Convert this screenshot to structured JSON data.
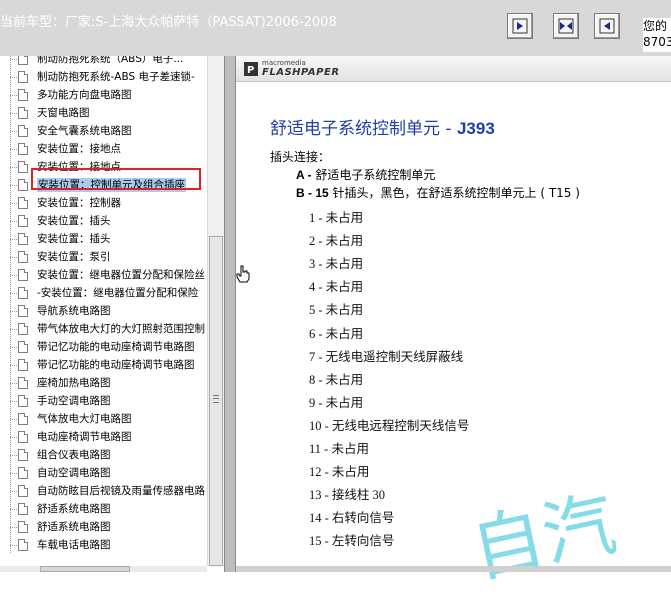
{
  "header": {
    "title": "当前车型：厂家:S-上海大众帕萨特（PASSAT)2006-2008",
    "right_info_line1": "您的",
    "right_info_line2": "8703"
  },
  "nav": {
    "icons": [
      "prev-page-icon",
      "fit-page-icon",
      "next-page-icon"
    ]
  },
  "tree": {
    "items": [
      {
        "label": "制动防抱死系统（ABS）电子..."
      },
      {
        "label": "制动防抱死系统-ABS 电子差速锁-"
      },
      {
        "label": "多功能方向盘电路图"
      },
      {
        "label": "天窗电路图"
      },
      {
        "label": "安全气囊系统电路图"
      },
      {
        "label": "安装位置：接地点"
      },
      {
        "label": "安装位置：接地点"
      },
      {
        "label": "安装位置：控制单元及组合插座",
        "selected": true
      },
      {
        "label": "安装位置：控制器"
      },
      {
        "label": "安装位置：插头"
      },
      {
        "label": "安装位置：插头"
      },
      {
        "label": "安装位置：泵引"
      },
      {
        "label": "安装位置：继电器位置分配和保险丝"
      },
      {
        "label": "-安装位置：继电器位置分配和保险"
      },
      {
        "label": "导航系统电路图"
      },
      {
        "label": "带气体放电大灯的大灯照射范围控制"
      },
      {
        "label": "带记忆功能的电动座椅调节电路图"
      },
      {
        "label": "带记忆功能的电动座椅调节电路图"
      },
      {
        "label": "座椅加热电路图"
      },
      {
        "label": "手动空调电路图"
      },
      {
        "label": "气体放电大灯电路图"
      },
      {
        "label": "电动座椅调节电路图"
      },
      {
        "label": "组合仪表电路图"
      },
      {
        "label": "自动空调电路图"
      },
      {
        "label": "自动防眩目后视镜及雨量传感器电路"
      },
      {
        "label": "舒适系统电路图"
      },
      {
        "label": "舒适系统电路图"
      },
      {
        "label": "车载电话电路图"
      }
    ]
  },
  "viewer": {
    "brand_top": "macromedia",
    "brand_name": "FLASHPAPER"
  },
  "document": {
    "title_cn": "舒适电子系统控制单元 - ",
    "title_code": "J393",
    "plug_label": "插头连接：",
    "plugs": [
      {
        "key": "A -",
        "text": " 舒适电子系统控制单元"
      },
      {
        "key": "B - 15",
        "text": " 针插头，黑色，在舒适系统控制单元上 ( T15 )"
      }
    ],
    "pins": [
      "1 - 未占用",
      "2 - 未占用",
      "3 - 未占用",
      "4 - 未占用",
      "5 - 未占用",
      "6 - 未占用",
      "7 - 无线电遥控制天线屏蔽线",
      "8 - 未占用",
      "9 - 未占用",
      "10 - 无线电远程控制天线信号",
      "11 - 未占用",
      "12 - 未占用",
      "13 - 接线柱 30",
      "14 - 右转向信号",
      "15 - 左转向信号"
    ],
    "watermark": "自汽"
  },
  "colors": {
    "title_blue": "#1f3ea8",
    "selection": "#aacbee",
    "highlight_red": "#e0202a",
    "watermark": "#6fd7e6"
  }
}
